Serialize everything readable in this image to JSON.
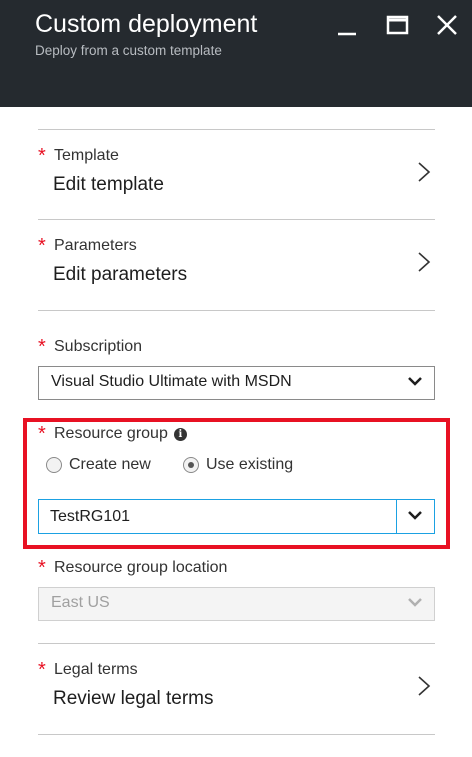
{
  "header": {
    "title": "Custom deployment",
    "subtitle": "Deploy from a custom template",
    "buttons": [
      "minimize-icon",
      "maximize-icon",
      "close-icon"
    ]
  },
  "required_marker": "*",
  "template": {
    "label": "Template",
    "value": "Edit template"
  },
  "parameters": {
    "label": "Parameters",
    "value": "Edit parameters"
  },
  "subscription": {
    "label": "Subscription",
    "selected": "Visual Studio Ultimate with MSDN"
  },
  "resource_group": {
    "label": "Resource group",
    "info_icon": "i",
    "options": {
      "create_new": "Create new",
      "use_existing": "Use existing"
    },
    "selected_option": "use_existing",
    "value": "TestRG101"
  },
  "location": {
    "label": "Resource group location",
    "selected": "East US",
    "disabled": true
  },
  "legal": {
    "label": "Legal terms",
    "value": "Review legal terms"
  },
  "colors": {
    "header_bg": "#252a2f",
    "required": "#e81123",
    "focus": "#1ba1e2",
    "highlight": "#e81123"
  }
}
